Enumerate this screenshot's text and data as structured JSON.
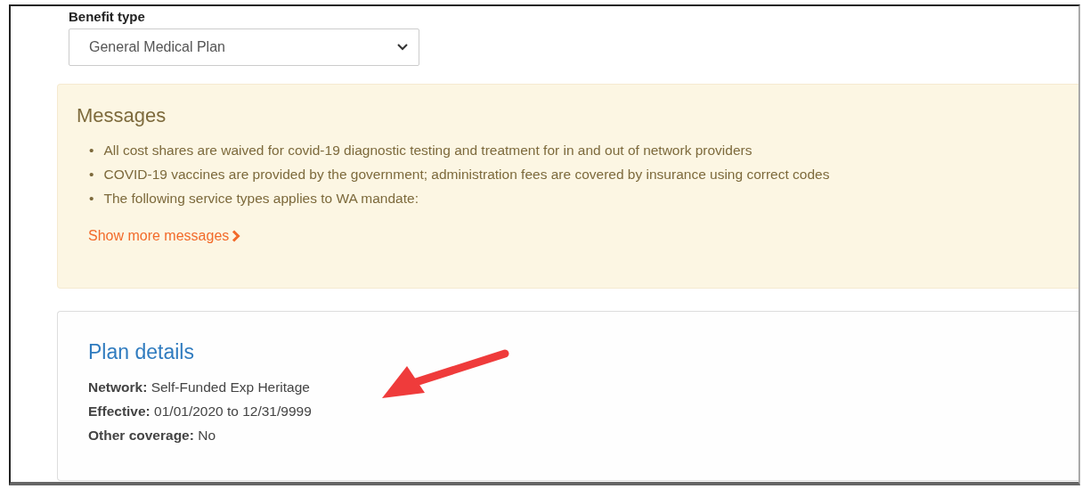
{
  "benefit_type": {
    "label": "Benefit type",
    "value": "General Medical Plan"
  },
  "messages": {
    "title": "Messages",
    "items": [
      {
        "marker": "•",
        "text": "All cost shares are waived for covid-19 diagnostic testing and treatment for in and out of network providers"
      },
      {
        "marker": "•",
        "text": "COVID-19 vaccines are provided by the government; administration fees are covered by insurance using correct codes"
      },
      {
        "marker": "•",
        "text": "The following service types applies to WA mandate:"
      }
    ],
    "link": "Show more messages"
  },
  "plan_details": {
    "title": "Plan details",
    "lines": [
      "**Network:** Self-Funded Exp Heritage",
      "**Effective:** 01/01/2020 to 12/31/9999",
      "**Other coverage:** No"
    ]
  }
}
